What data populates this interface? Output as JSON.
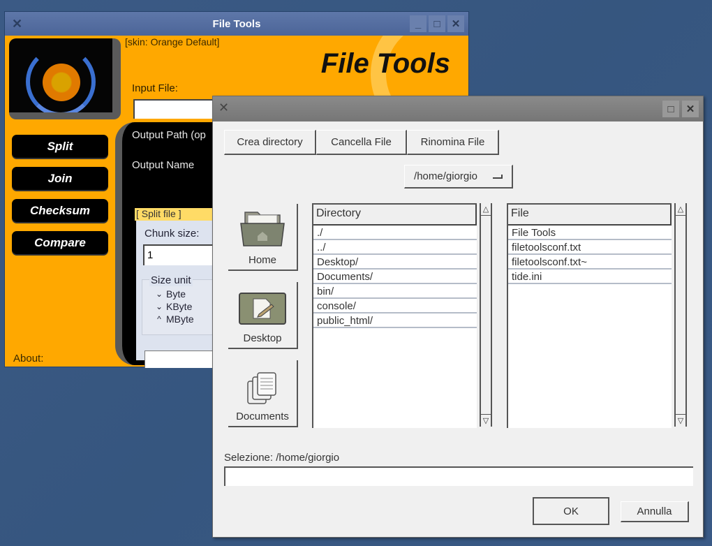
{
  "main_window": {
    "title": "File Tools",
    "skin_label": "[skin: Orange Default]",
    "brand_title": "File Tools",
    "input_file_label": "Input File:",
    "input_file_value": "",
    "browse_icon": "folder-open-icon",
    "nav_buttons": [
      {
        "label": "Split"
      },
      {
        "label": "Join"
      },
      {
        "label": "Checksum"
      },
      {
        "label": "Compare"
      }
    ],
    "about_label": "About:",
    "output_path_label": "Output Path (op",
    "output_name_label": "Output Name",
    "split_tab_label": "[ Split file ]",
    "chunk_size_label": "Chunk size:",
    "chunk_size_value": "1",
    "size_unit_label": "Size unit",
    "size_units": [
      {
        "label": "Byte",
        "selected": false
      },
      {
        "label": "KByte",
        "selected": false
      },
      {
        "label": "MByte",
        "selected": true
      }
    ],
    "colors": {
      "skin": "#ffa800",
      "titlebar": "#5a73a6"
    }
  },
  "dialog": {
    "title": "",
    "toolbar": {
      "create_dir": "Crea directory",
      "delete_file": "Cancella File",
      "rename_file": "Rinomina File"
    },
    "path_dropdown": "/home/giorgio",
    "places": [
      {
        "label": "Home",
        "icon": "home-folder-icon"
      },
      {
        "label": "Desktop",
        "icon": "desktop-icon"
      },
      {
        "label": "Documents",
        "icon": "documents-icon"
      }
    ],
    "directory_list": {
      "header": "Directory",
      "items": [
        "./",
        "../",
        "Desktop/",
        "Documents/",
        "bin/",
        "console/",
        "public_html/"
      ]
    },
    "file_list": {
      "header": "File",
      "items": [
        "File Tools",
        "filetoolsconf.txt",
        "filetoolsconf.txt~",
        "tide.ini"
      ]
    },
    "selection_label": "Selezione: /home/giorgio",
    "selection_value": "",
    "ok_label": "OK",
    "cancel_label": "Annulla"
  }
}
